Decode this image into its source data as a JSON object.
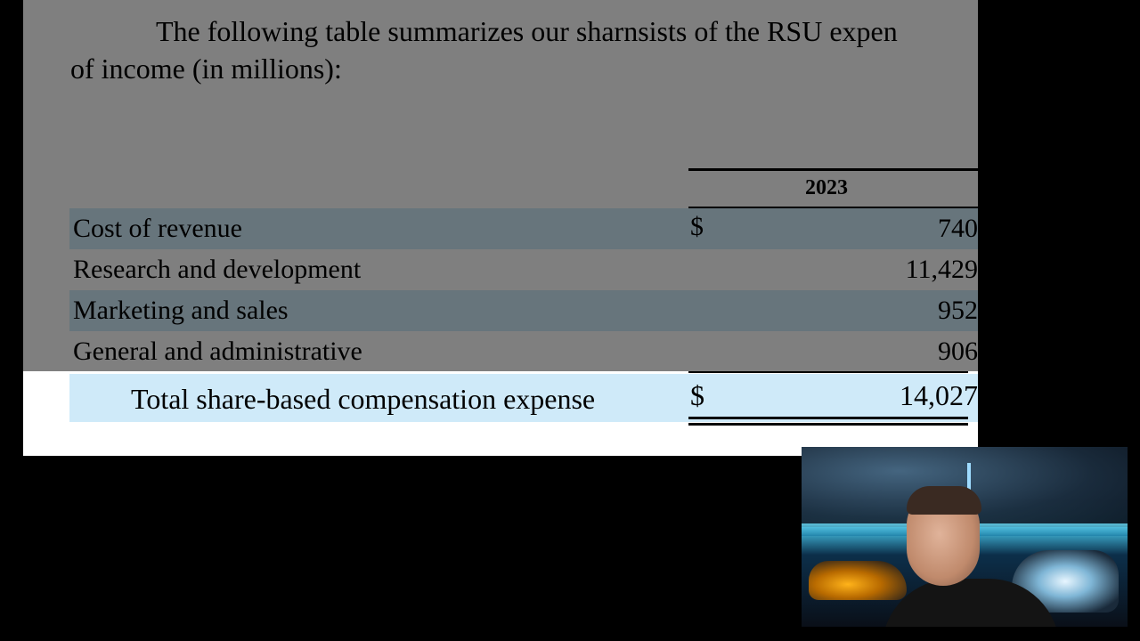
{
  "intro": {
    "line1": "The following table summarizes our sharnsists of the RSU expen",
    "line2": "of income (in millions):"
  },
  "table": {
    "year_header": "2023",
    "rows": [
      {
        "label": "Cost of revenue",
        "currency": "$",
        "value": "740"
      },
      {
        "label": "Research and development",
        "currency": "",
        "value": "11,429"
      },
      {
        "label": "Marketing and sales",
        "currency": "",
        "value": "952"
      },
      {
        "label": "General and administrative",
        "currency": "",
        "value": "906"
      }
    ],
    "total": {
      "label": "Total share-based compensation expense",
      "currency": "$",
      "value": "14,027"
    }
  },
  "colors": {
    "row_highlight": "#cfeaf9",
    "dim_overlay": "rgba(0,0,0,0.5)",
    "background": "#000000"
  }
}
